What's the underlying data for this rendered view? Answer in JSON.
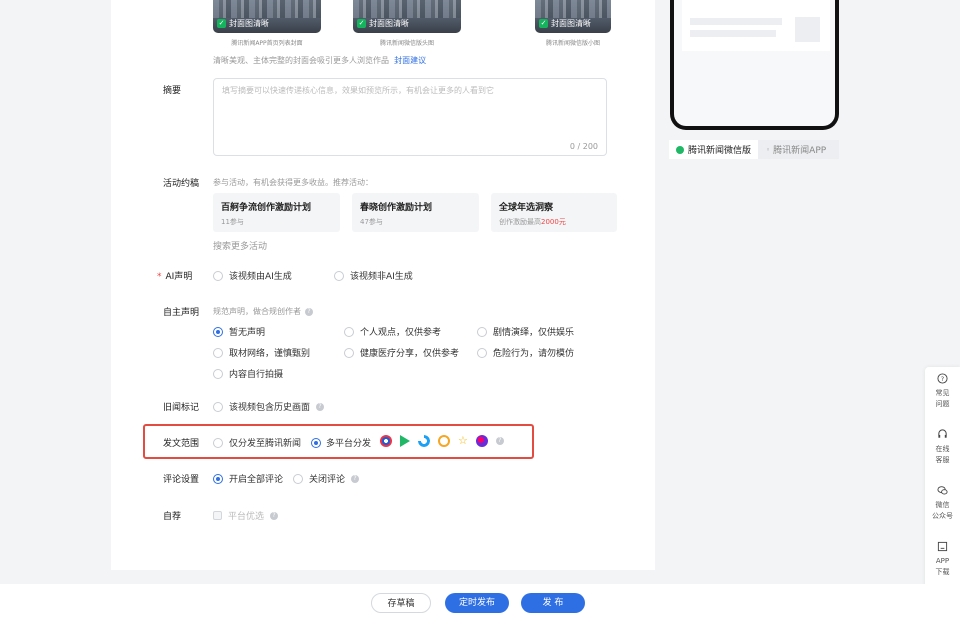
{
  "cover": {
    "thumbs": [
      {
        "tag": "封面图清晰",
        "caption": "腾讯新闻APP首页列表封面"
      },
      {
        "tag": "封面图清晰",
        "caption": "腾讯新闻微信版头图"
      },
      {
        "tag": "封面图清晰",
        "caption": "腾讯新闻微信版小图"
      }
    ],
    "hint": "清晰美观、主体完整的封面会吸引更多人浏览作品",
    "hint_link": "封面建议"
  },
  "summary": {
    "label": "摘要",
    "placeholder": "填写摘要可以快速传递核心信息，效果如预览所示，有机会让更多的人看到它",
    "count": "0 / 200"
  },
  "activity": {
    "label": "活动约稿",
    "desc": "参与活动，有机会获得更多收益。推荐活动：",
    "cards": [
      {
        "title": "百舸争流创作激励计划",
        "sub": "11参与",
        "sub_hl": ""
      },
      {
        "title": "春晓创作激励计划",
        "sub": "47参与",
        "sub_hl": ""
      },
      {
        "title": "全球年选洞察",
        "sub": "创作激励最高",
        "sub_hl": "2000元"
      }
    ],
    "more": "搜索更多活动"
  },
  "ai": {
    "required_mark": "*",
    "label": "AI声明",
    "options": [
      "该视频由AI生成",
      "该视频非AI生成"
    ]
  },
  "self": {
    "label": "自主声明",
    "desc": "规范声明，做合规创作者",
    "options": [
      "暂无声明",
      "个人观点，仅供参考",
      "剧情演绎，仅供娱乐",
      "取材网络，谨慎甄别",
      "健康医疗分享，仅供参考",
      "危险行为，请勿模仿",
      "内容自行拍摄"
    ],
    "selected": "暂无声明"
  },
  "old_news": {
    "label": "旧闻标记",
    "option": "该视频包含历史画面"
  },
  "scope": {
    "label": "发文范围",
    "options": [
      "仅分发至腾讯新闻",
      "多平台分发"
    ],
    "selected": "多平台分发",
    "platform_icons": [
      "platform-a-icon",
      "platform-b-icon",
      "platform-c-icon",
      "platform-d-icon",
      "platform-e-icon",
      "platform-f-icon"
    ]
  },
  "comment": {
    "label": "评论设置",
    "options": [
      "开启全部评论",
      "关闭评论"
    ],
    "selected": "开启全部评论"
  },
  "recommend": {
    "label": "自荐",
    "option": "平台优选"
  },
  "preview": {
    "tab_wechat": "腾讯新闻微信版",
    "tab_app": "腾讯新闻APP"
  },
  "sidebar": [
    {
      "label1": "常见",
      "label2": "问题"
    },
    {
      "label1": "在线",
      "label2": "客服"
    },
    {
      "label1": "微信",
      "label2": "公众号"
    },
    {
      "label1": "APP",
      "label2": "下载"
    }
  ],
  "footer": {
    "draft": "存草稿",
    "schedule": "定时发布",
    "publish": "发 布"
  }
}
